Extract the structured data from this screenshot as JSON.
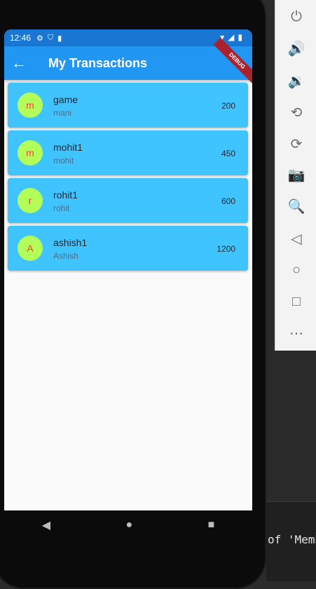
{
  "status_bar": {
    "time": "12:46"
  },
  "app_bar": {
    "title": "My Transactions",
    "debug_label": "DEBUG"
  },
  "transactions": [
    {
      "initial": "m",
      "title": "game",
      "subtitle": "mani",
      "amount": "200"
    },
    {
      "initial": "m",
      "title": "mohit1",
      "subtitle": "mohit",
      "amount": "450"
    },
    {
      "initial": "r",
      "title": "rohit1",
      "subtitle": "rohit",
      "amount": "600"
    },
    {
      "initial": "A",
      "title": "ashish1",
      "subtitle": "Ashish",
      "amount": "1200"
    }
  ],
  "ide": {
    "text": "of 'Memb"
  },
  "icons": {
    "back": "arrow-left-icon",
    "power": "power-icon",
    "volume_up": "volume-up-icon",
    "volume_down": "volume-down-icon",
    "rotate_left": "rotate-left-icon",
    "rotate_right": "rotate-right-icon",
    "camera": "camera-icon",
    "zoom": "zoom-in-icon",
    "nav_back": "triangle-back-icon",
    "nav_home": "circle-home-icon",
    "nav_overview": "square-overview-icon",
    "more": "more-icon"
  },
  "colors": {
    "app_bar": "#2196f3",
    "status_bar": "#1976d2",
    "card": "#40c4ff",
    "avatar_bg": "#b2ff59",
    "avatar_text": "#f44336"
  }
}
